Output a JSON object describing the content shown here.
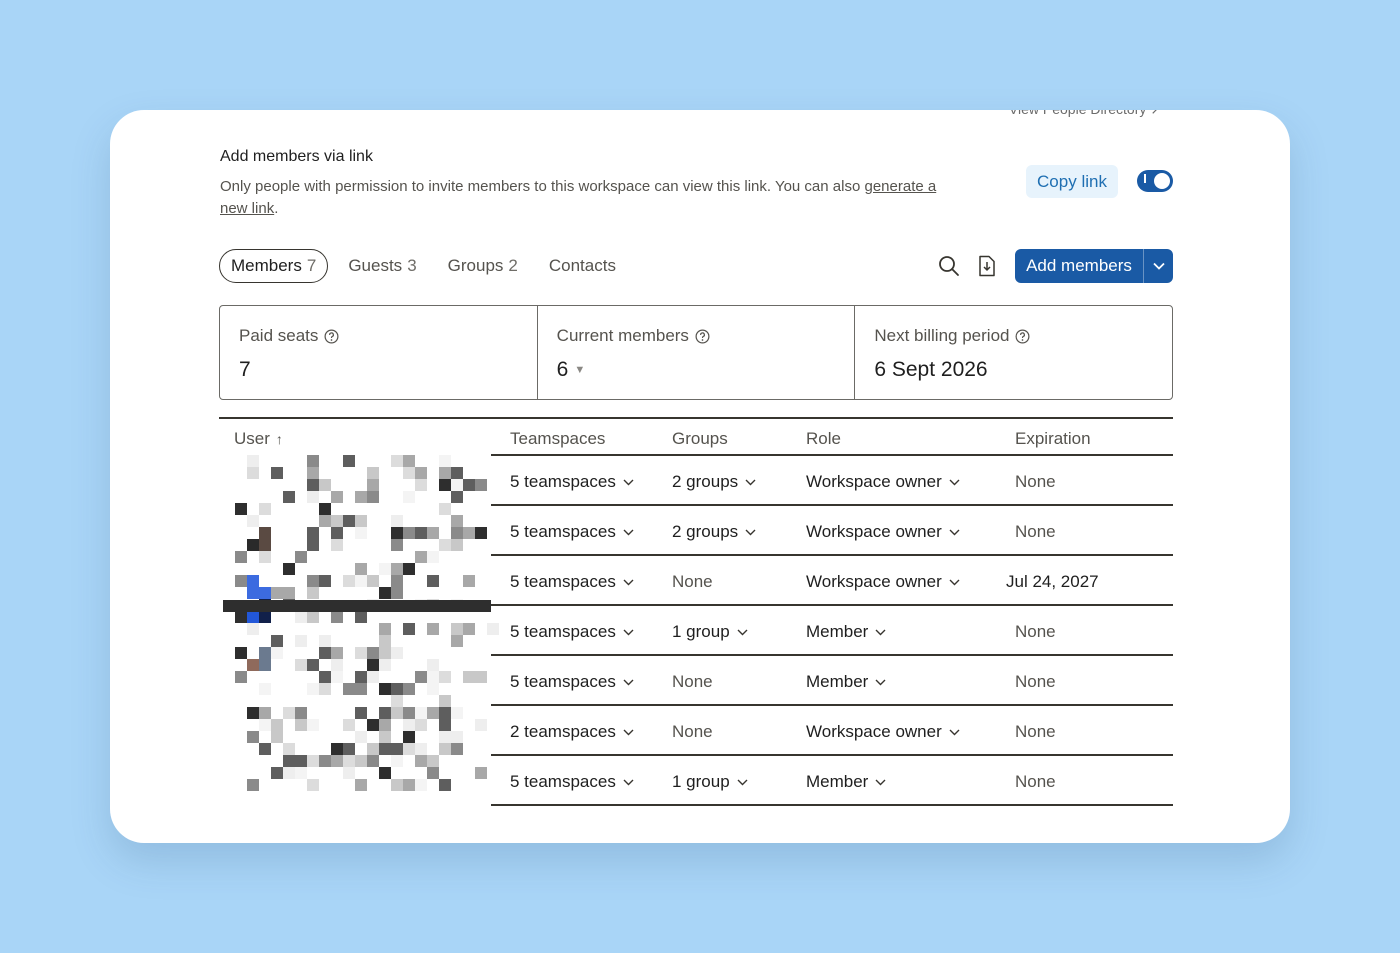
{
  "invite": {
    "top_link": "View People Directory ↗",
    "title": "Add members via link",
    "description": "Only people with permission to invite members to this workspace can view this link. You can also ",
    "generate_link": "generate a new link",
    "period": ".",
    "copy_link": "Copy link",
    "toggle_on": true
  },
  "tabs": [
    {
      "label": "Members",
      "count": "7",
      "active": true
    },
    {
      "label": "Guests",
      "count": "3",
      "active": false
    },
    {
      "label": "Groups",
      "count": "2",
      "active": false
    },
    {
      "label": "Contacts",
      "count": "",
      "active": false
    }
  ],
  "toolbar": {
    "search_icon": "search-icon",
    "export_icon": "export-file-icon",
    "add_members": "Add members"
  },
  "stats": {
    "paid_seats_label": "Paid seats",
    "paid_seats": "7",
    "current_members_label": "Current members",
    "current_members": "6",
    "next_billing_label": "Next billing period",
    "next_billing": "6 Sept 2026"
  },
  "table": {
    "headers": {
      "user": "User",
      "user_sort": "↑",
      "teamspaces": "Teamspaces",
      "groups": "Groups",
      "role": "Role",
      "expiration": "Expiration"
    },
    "rows": [
      {
        "teamspaces": "5 teamspaces",
        "groups": "2 groups",
        "groups_dropdown": true,
        "role": "Workspace owner",
        "expiration": "None"
      },
      {
        "teamspaces": "5 teamspaces",
        "groups": "2 groups",
        "groups_dropdown": true,
        "role": "Workspace owner",
        "expiration": "None"
      },
      {
        "teamspaces": "5 teamspaces",
        "groups": "None",
        "groups_dropdown": false,
        "role": "Workspace owner",
        "expiration": "Jul 24, 2027"
      },
      {
        "teamspaces": "5 teamspaces",
        "groups": "1 group",
        "groups_dropdown": true,
        "role": "Member",
        "expiration": "None"
      },
      {
        "teamspaces": "5 teamspaces",
        "groups": "None",
        "groups_dropdown": false,
        "role": "Member",
        "expiration": "None"
      },
      {
        "teamspaces": "2 teamspaces",
        "groups": "None",
        "groups_dropdown": false,
        "role": "Workspace owner",
        "expiration": "None"
      },
      {
        "teamspaces": "5 teamspaces",
        "groups": "1 group",
        "groups_dropdown": true,
        "role": "Member",
        "expiration": "None"
      }
    ]
  },
  "colors": {
    "background": "#a9d5f7",
    "accent": "#1a5aa5",
    "copy_link_bg": "#e7f3fc",
    "copy_link_text": "#1f6fb2"
  }
}
